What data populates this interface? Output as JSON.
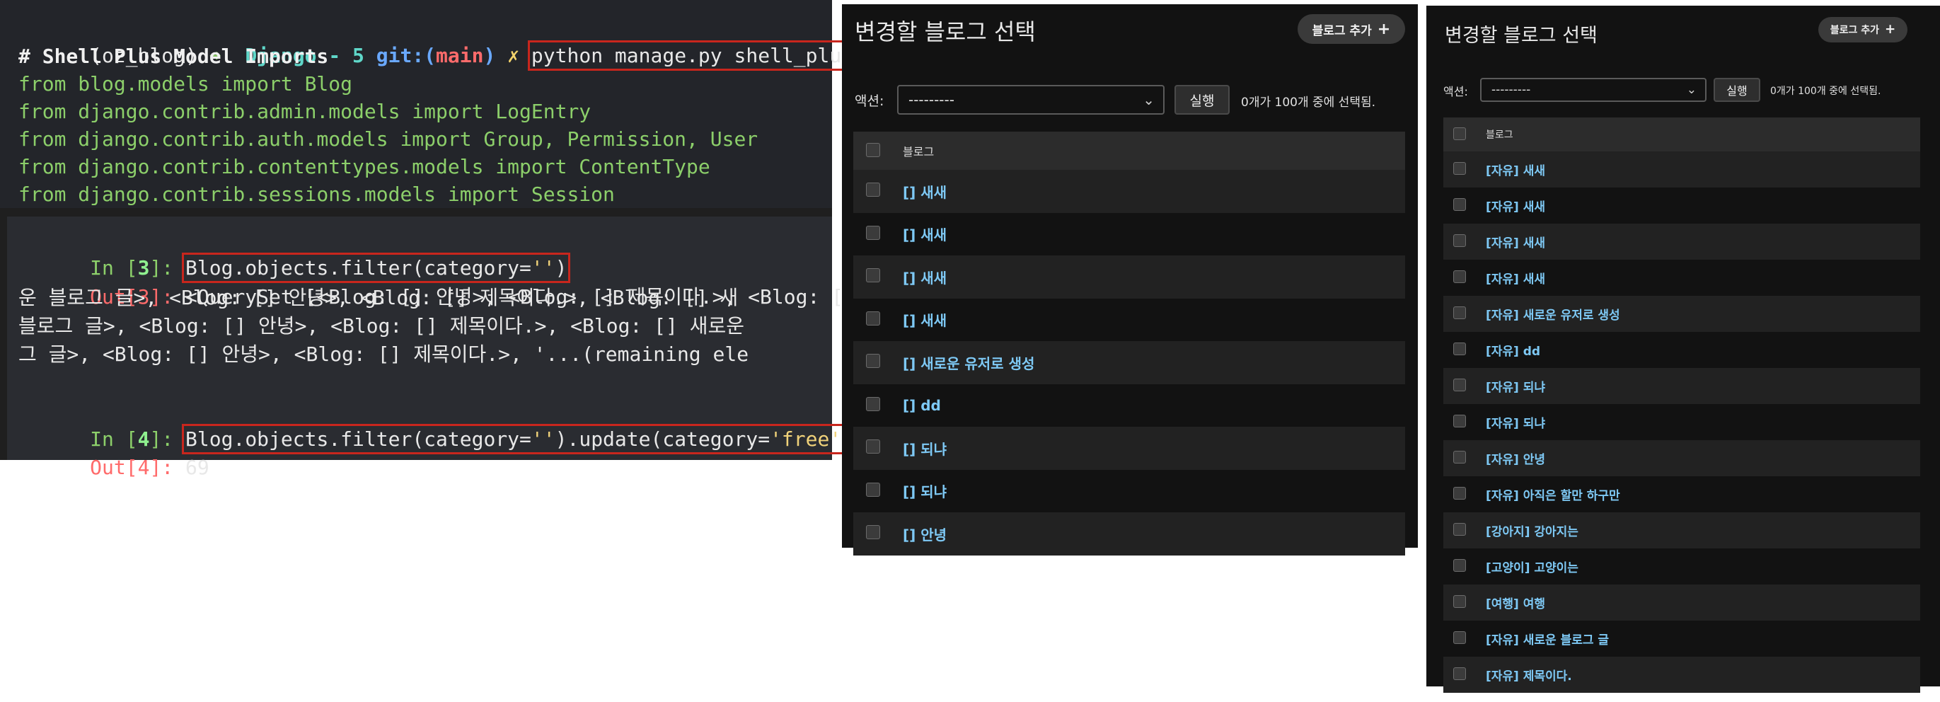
{
  "terminal": {
    "prompt": {
      "env": "(oz_blog)",
      "arrow": "➜",
      "dir": "Django - 5",
      "git_label": "git:",
      "branch_open": "(",
      "branch": "main",
      "branch_close": ")",
      "dirty": "✗",
      "command": "python manage.py shell_plus"
    },
    "imports_header": "# Shell Plus Model Imports",
    "imports": [
      "from blog.models import Blog",
      "from django.contrib.admin.models import LogEntry",
      "from django.contrib.auth.models import Group, Permission, User",
      "from django.contrib.contenttypes.models import ContentType",
      "from django.contrib.sessions.models import Session"
    ],
    "in3_label": "In [",
    "in3_num": "3",
    "in3_close": "]: ",
    "in3_code_a": "Blog.objects.filter(category=",
    "in3_code_str": "''",
    "in3_code_b": ")",
    "out3_label": "Out[3]: ",
    "out3_lines": [
      "<QuerySet [<Blog: [] 안녕>, <Blog: [] 제목이다.>, <Blog: [",
      "운 블로그 글>, <Blog: [] 안녕>, <Blog: [] 제목이다.>, <Blog: [] 새",
      "블로그 글>, <Blog: [] 안녕>, <Blog: [] 제목이다.>, <Blog: [] 새로운",
      "그 글>, <Blog: [] 안녕>, <Blog: [] 제목이다.>, '...(remaining ele"
    ],
    "in4_label": "In [",
    "in4_num": "4",
    "in4_close": "]: ",
    "in4_code_a": "Blog.objects.filter(category=",
    "in4_code_str1": "''",
    "in4_code_b": ").update(category=",
    "in4_code_str2": "'free'",
    "in4_code_c": ")",
    "out4_label": "Out[4]: ",
    "out4_value": "69"
  },
  "panel_before": {
    "title": "변경할 블로그 선택",
    "add_button": "블로그 추가",
    "action_label": "액션:",
    "action_value": "---------",
    "run_button": "실행",
    "selection_info": "0개가 100개 중에 선택됨.",
    "column_header": "블로그",
    "rows": [
      "[] 새새",
      "[] 새새",
      "[] 새새",
      "[] 새새",
      "[] 새로운 유저로 생성",
      "[] dd",
      "[] 되냐",
      "[] 되냐",
      "[] 안녕"
    ]
  },
  "panel_after": {
    "title": "변경할 블로그 선택",
    "add_button": "블로그 추가",
    "action_label": "액션:",
    "action_value": "---------",
    "run_button": "실행",
    "selection_info": "0개가 100개 중에 선택됨.",
    "column_header": "블로그",
    "rows": [
      "[자유] 새새",
      "[자유] 새새",
      "[자유] 새새",
      "[자유] 새새",
      "[자유] 새로운 유저로 생성",
      "[자유] dd",
      "[자유] 되냐",
      "[자유] 되냐",
      "[자유] 안녕",
      "[자유] 아직은 할만 하구만",
      "[강아지] 강아지는",
      "[고양이] 고양이는",
      "[여행] 여행",
      "[자유] 새로운 블로그 글",
      "[자유] 제목이다."
    ]
  },
  "icons": {
    "plus": "+",
    "chevron": "⌄"
  }
}
